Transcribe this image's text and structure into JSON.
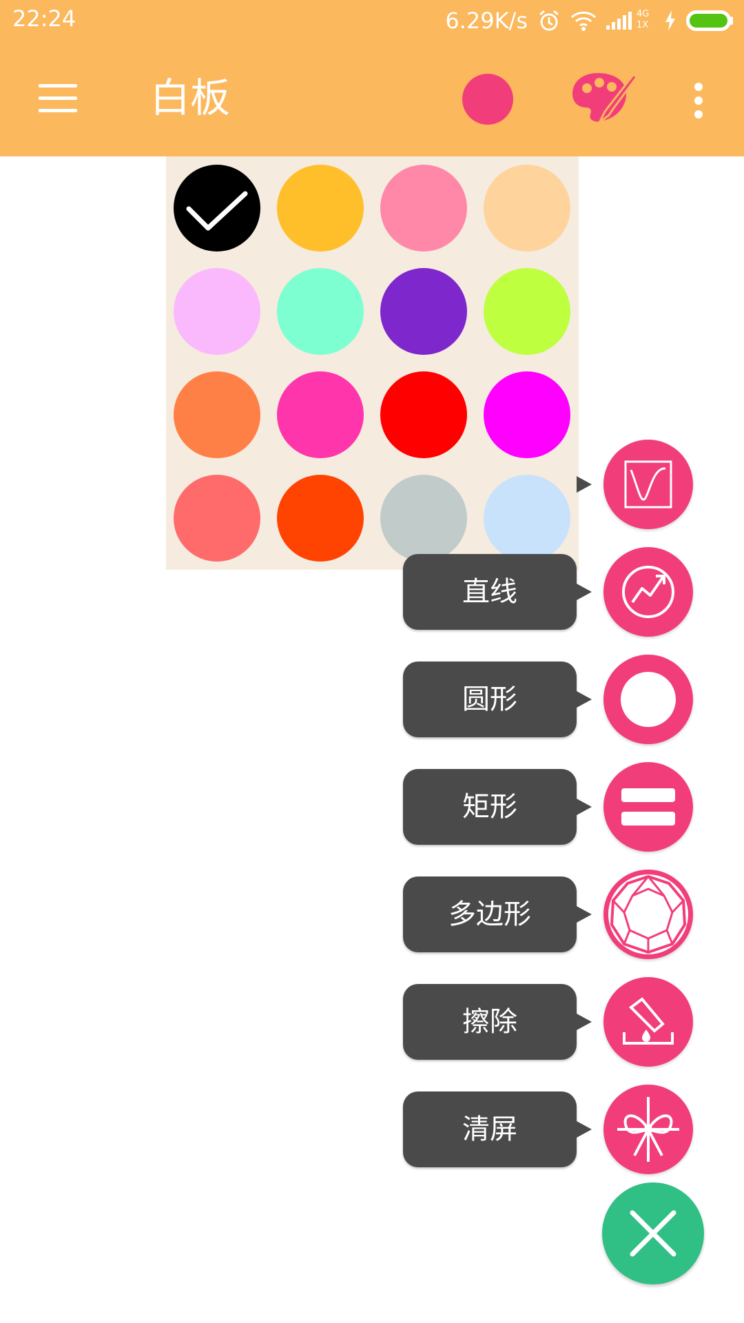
{
  "status_bar": {
    "time": "22:24",
    "net_speed": "6.29K/s",
    "icons": [
      "alarm-icon",
      "wifi-icon",
      "signal-icon",
      "charging-icon",
      "battery-icon"
    ],
    "network_badge_top": "4G",
    "network_badge_bottom": "1X"
  },
  "toolbar": {
    "menu_icon": "hamburger-menu-icon",
    "title": "白板",
    "current_color": "#f23d7b",
    "palette_icon": "palette-icon",
    "more_icon": "more-vertical-icon"
  },
  "color_picker": {
    "selected_index": 0,
    "colors": [
      "#000000",
      "#ffbf2a",
      "#ff88a8",
      "#ffd39c",
      "#fbb9fd",
      "#7dffd1",
      "#7e27cc",
      "#beff3f",
      "#ff8047",
      "#ff35ac",
      "#ff0000",
      "#ff00ff",
      "#ff6b6b",
      "#ff4402",
      "#c0cbca",
      "#c8e2fc"
    ]
  },
  "tool_menu": {
    "items": [
      {
        "label": "",
        "icon": "freehand-curve-icon"
      },
      {
        "label": "直线",
        "icon": "line-chart-icon"
      },
      {
        "label": "圆形",
        "icon": "circle-ring-icon"
      },
      {
        "label": "矩形",
        "icon": "rectangle-icon"
      },
      {
        "label": "多边形",
        "icon": "polygon-diamond-icon"
      },
      {
        "label": "擦除",
        "icon": "eraser-icon"
      },
      {
        "label": "清屏",
        "icon": "clear-screen-icon"
      }
    ],
    "close_icon": "close-icon"
  },
  "colors": {
    "appbar": "#fbb85c",
    "accent_pink": "#f23d7b",
    "fab_close": "#30bf84",
    "label_bg": "#4a4a4a",
    "popup_bg": "#f6ebdf"
  }
}
